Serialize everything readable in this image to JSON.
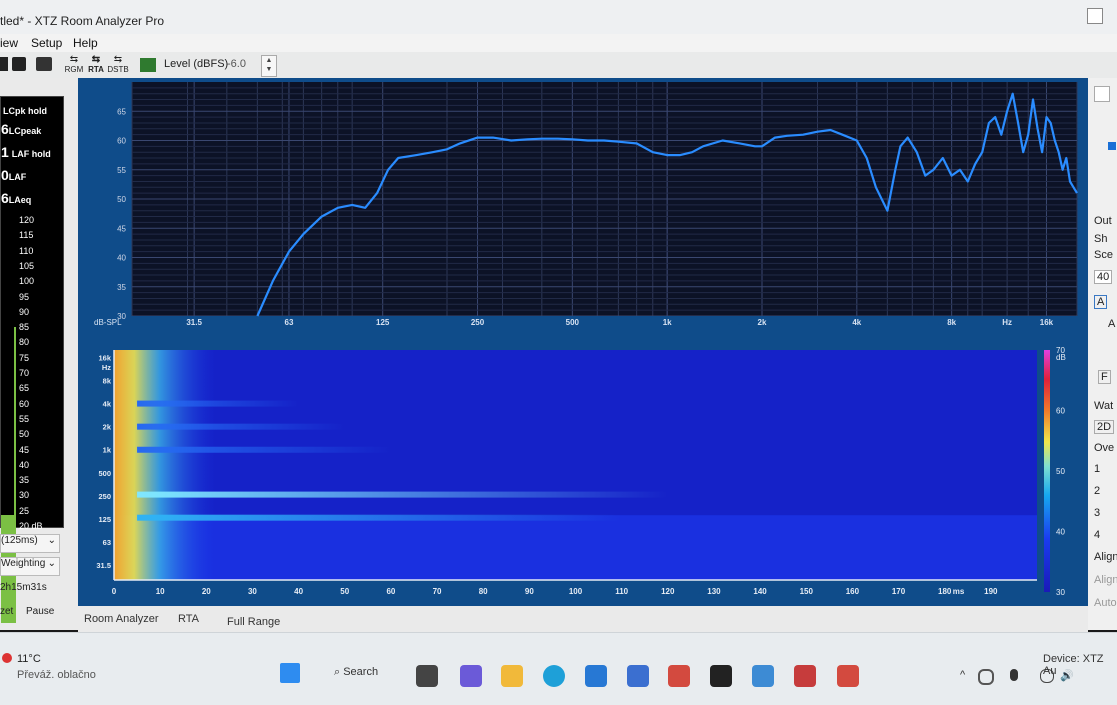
{
  "window": {
    "title": "tled* - XTZ Room Analyzer Pro"
  },
  "menu": [
    "iew",
    "Setup",
    "Help"
  ],
  "toolbar": {
    "buttons": [
      "RGM",
      "RTA",
      "DSTB"
    ],
    "level_label": "Level (dBFS)",
    "level_value": "-6.0"
  },
  "meter": {
    "readouts": [
      {
        "value": "",
        "label": "LCpk hold"
      },
      {
        "value": "6",
        "label": "LCpeak"
      },
      {
        "value": "1",
        "label": "LAF hold"
      },
      {
        "value": "0",
        "label": "LAF"
      },
      {
        "value": "6",
        "label": "LAeq"
      }
    ],
    "scale": [
      "120",
      "115",
      "110",
      "105",
      "100",
      "95",
      "90",
      "85",
      "80",
      "75",
      "70",
      "65",
      "60",
      "55",
      "50",
      "45",
      "40",
      "35",
      "30",
      "25",
      "20 dB"
    ],
    "controls": [
      "(125ms)",
      "Weighting",
      "2h15m31s"
    ],
    "buttons": [
      "zet",
      "Pause"
    ]
  },
  "chart_data": [
    {
      "type": "line",
      "ylabel": "dB-SPL",
      "xlabel": "Hz",
      "x_scale": "log",
      "xlim": [
        20,
        20000
      ],
      "ylim": [
        30,
        70
      ],
      "ytick_labels": [
        "30",
        "35",
        "40",
        "45",
        "50",
        "55",
        "60",
        "65"
      ],
      "xtick_labels": [
        {
          "x": 31.5,
          "label": "31.5"
        },
        {
          "x": 63,
          "label": "63"
        },
        {
          "x": 125,
          "label": "125"
        },
        {
          "x": 250,
          "label": "250"
        },
        {
          "x": 500,
          "label": "500"
        },
        {
          "x": 1000,
          "label": "1k"
        },
        {
          "x": 2000,
          "label": "2k"
        },
        {
          "x": 4000,
          "label": "4k"
        },
        {
          "x": 8000,
          "label": "8k"
        },
        {
          "x": 16000,
          "label": "16k"
        }
      ],
      "grid": true,
      "color": "#2a8cff",
      "series": [
        {
          "x": [
            50,
            56,
            63,
            70,
            80,
            90,
            100,
            110,
            120,
            130,
            140,
            160,
            180,
            200,
            220,
            250,
            280,
            320,
            360,
            400,
            450,
            500,
            560,
            630,
            700,
            800,
            900,
            1000,
            1100,
            1200,
            1300,
            1500,
            1700,
            1900,
            2000,
            2200,
            2400,
            2700,
            3000,
            3300,
            3600,
            4000,
            4300,
            4600,
            5000,
            5300,
            5500,
            5800,
            6200,
            6600,
            7000,
            7500,
            8000,
            8500,
            9000,
            9500,
            10000,
            10500,
            11000,
            11500,
            12000,
            12500,
            13000,
            13500,
            14000,
            14500,
            15000,
            15500,
            16000,
            16500,
            17000,
            17500,
            18000,
            18500,
            19000,
            19500,
            20000
          ],
          "y": [
            30,
            36,
            41,
            44,
            47,
            48.5,
            49,
            48.5,
            51,
            55,
            57,
            57.5,
            58,
            58.5,
            59.5,
            60.5,
            60.5,
            60,
            60.2,
            60.3,
            60.3,
            60.2,
            60,
            60,
            59.8,
            59.5,
            58,
            57.5,
            57.5,
            58,
            59,
            60,
            59.5,
            59,
            59,
            60.5,
            60.8,
            61,
            61.5,
            61.8,
            61,
            60,
            57,
            52,
            48,
            55,
            59,
            60.5,
            58,
            54,
            55,
            57,
            54,
            55,
            53,
            56,
            58,
            63,
            64,
            61,
            65,
            68,
            63,
            58,
            61,
            67,
            62,
            58,
            64,
            63,
            60,
            58,
            55,
            57,
            53,
            52,
            51
          ]
        }
      ]
    },
    {
      "type": "heatmap",
      "xlabel": "ms",
      "ylabel": "Hz",
      "colorbar_label": "dB",
      "xlim": [
        0,
        200
      ],
      "ylim": [
        20,
        20000
      ],
      "y_scale": "log",
      "clim": [
        30,
        70
      ],
      "xtick_labels": [
        "0",
        "10",
        "20",
        "30",
        "40",
        "50",
        "60",
        "70",
        "80",
        "90",
        "100",
        "110",
        "120",
        "130",
        "140",
        "150",
        "160",
        "170",
        "180",
        "190"
      ],
      "ytick_labels": [
        "31.5",
        "63",
        "125",
        "250",
        "500",
        "1k",
        "2k",
        "4k",
        "8k",
        "16k"
      ],
      "colorbar_ticks": [
        "30",
        "40",
        "50",
        "60",
        "70"
      ],
      "bands": [
        {
          "freq": 260,
          "level": 55,
          "decay_ms": 120
        },
        {
          "freq": 130,
          "level": 47,
          "decay_ms": 110
        },
        {
          "freq": 1000,
          "level": 41,
          "decay_ms": 60
        },
        {
          "freq": 2000,
          "level": 41,
          "decay_ms": 50
        },
        {
          "freq": 4000,
          "level": 40,
          "decay_ms": 40
        }
      ]
    }
  ],
  "bottom_tabs": [
    "Room Analyzer",
    "RTA",
    "Full Range"
  ],
  "right_panel": [
    "Out",
    "Sh",
    "Sce",
    "40",
    "A",
    "A",
    "F",
    "Wat",
    "2D",
    "Ove",
    "1",
    "2",
    "3",
    "4",
    "Align",
    "Align",
    "Auto"
  ],
  "taskbar": {
    "weather_temp": "11°C",
    "weather_desc": "Převáž. oblačno",
    "search": "Search",
    "device": "Device: XTZ Au"
  }
}
